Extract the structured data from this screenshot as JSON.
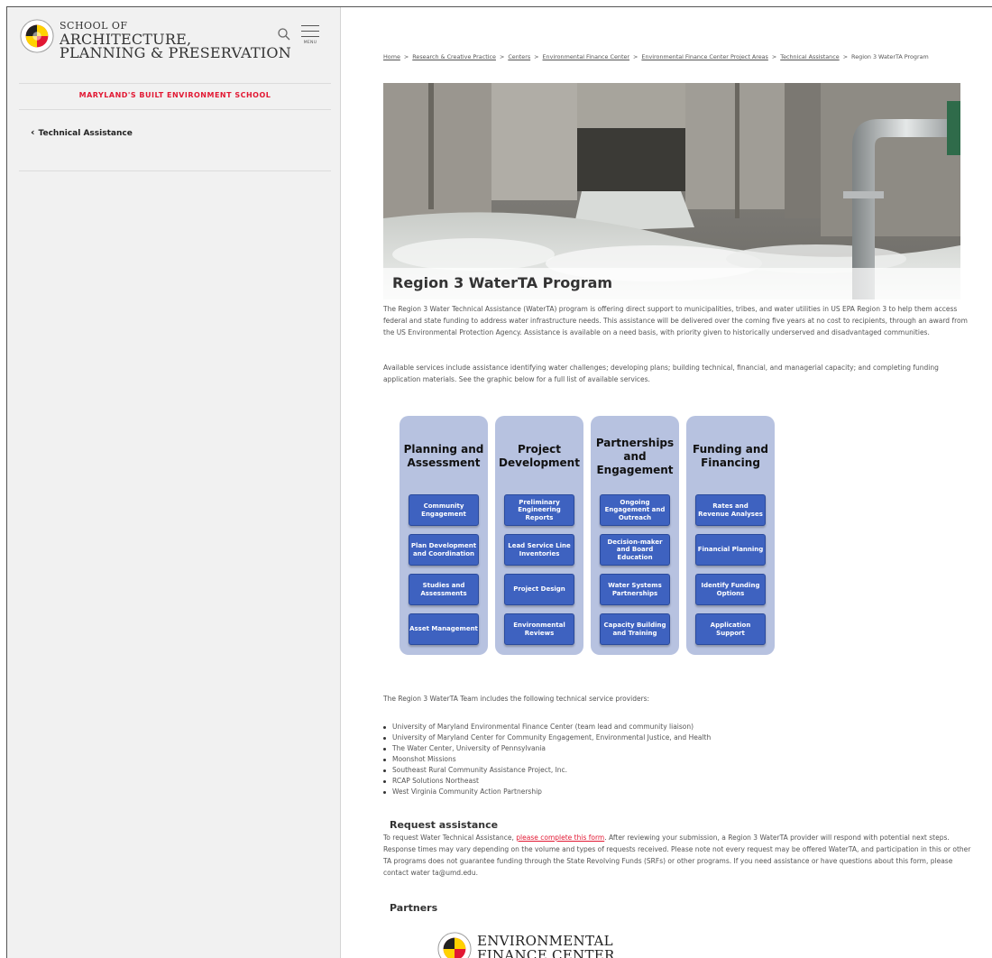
{
  "header": {
    "brand_line1": "SCHOOL OF",
    "brand_line2": "ARCHITECTURE,",
    "brand_line3": "PLANNING & PRESERVATION",
    "menu_label": "MENU",
    "tagline": "MARYLAND'S BUILT ENVIRONMENT SCHOOL",
    "back_link": "Technical Assistance"
  },
  "breadcrumbs": [
    "Home",
    "Research & Creative Practice",
    "Centers",
    "Environmental Finance Center",
    "Environmental Finance Center Project Areas",
    "Technical Assistance",
    "Region 3 WaterTA Program"
  ],
  "hero": {
    "title": "Region 3 WaterTA Program"
  },
  "intro": {
    "p1": "The Region 3 Water Technical Assistance (WaterTA) program is offering direct support to municipalities, tribes, and water utilities in US EPA Region 3 to help them access federal and state funding to address water infrastructure needs. This assistance will be delivered over the coming five years at no cost to recipients, through an award from the US Environmental Protection Agency.  Assistance is available on a need basis, with priority given to historically underserved and disadvantaged communities.",
    "p2": "Available services include assistance identifying water challenges; developing plans; building technical, financial, and managerial capacity; and completing funding application materials.  See the graphic below for a full list of available services."
  },
  "services": [
    {
      "title": "Planning and Assessment",
      "items": [
        "Community Engagement",
        "Plan Development and Coordination",
        "Studies and Assessments",
        "Asset Management"
      ]
    },
    {
      "title": "Project Development",
      "items": [
        "Preliminary Engineering Reports",
        "Lead Service Line Inventories",
        "Project Design",
        "Environmental Reviews"
      ]
    },
    {
      "title": "Partnerships and Engagement",
      "items": [
        "Ongoing Engagement and Outreach",
        "Decision-maker and Board Education",
        "Water Systems Partnerships",
        "Capacity Building and Training"
      ]
    },
    {
      "title": "Funding and Financing",
      "items": [
        "Rates and Revenue Analyses",
        "Financial Planning",
        "Identify Funding Options",
        "Application Support"
      ]
    }
  ],
  "team": {
    "intro": "The Region 3 WaterTA Team includes the following technical service providers:",
    "providers": [
      "University of Maryland Environmental Finance Center (team lead and community liaison)",
      "University of Maryland Center for Community Engagement, Environmental Justice, and Health",
      "The Water Center, University of Pennsylvania",
      "Moonshot Missions",
      "Southeast Rural Community Assistance Project, Inc.",
      "RCAP Solutions Northeast",
      "West Virginia Community Action Partnership"
    ]
  },
  "request": {
    "heading": "Request assistance",
    "text_before": "To request Water Technical Assistance, ",
    "link": "please complete this form",
    "text_after": ". After reviewing your submission, a Region 3 WaterTA provider will respond with potential next steps. Response times may vary depending on the volume and types of requests received. Please note not every request may be offered WaterTA, and participation in this or other TA programs does not guarantee funding through the State Revolving Funds (SRFs) or other programs. If you need assistance or have questions about this form, please contact water ta@umd.edu."
  },
  "partners": {
    "heading": "Partners",
    "logo_line1": "ENVIRONMENTAL",
    "logo_line2": "FINANCE CENTER"
  },
  "colors": {
    "accent_red": "#e21833",
    "box_blue": "#3e62c0",
    "column_bg": "#b7c2e0"
  }
}
